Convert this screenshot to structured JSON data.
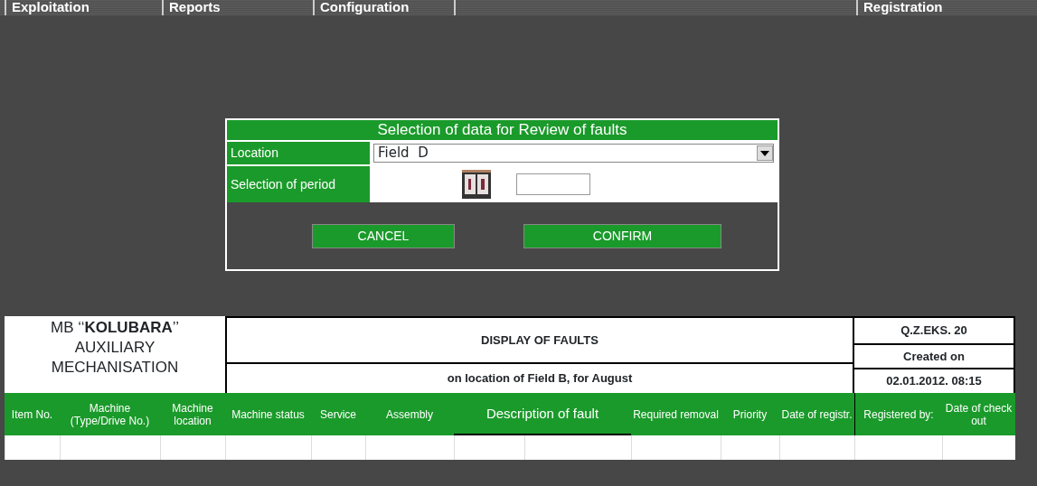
{
  "menu": {
    "left": [
      {
        "label": "Exploitation"
      },
      {
        "label": "Reports"
      },
      {
        "label": "Configuration"
      }
    ],
    "right": [
      {
        "label": "Registration"
      }
    ]
  },
  "dialog": {
    "title": "Selection of data for Review of faults",
    "location": {
      "label": "Location",
      "value": "Field  D"
    },
    "period": {
      "label": "Selection of period"
    },
    "buttons": [
      {
        "label": "CANCEL"
      },
      {
        "label": "CONFIRM"
      }
    ]
  },
  "report": {
    "org": [
      "MB ‘‘**KOLUBARA**’’",
      "AUXILIARY",
      "MECHANISATION"
    ],
    "title": "DISPLAY OF FAULTS",
    "subtitle": "on location of Field B, for August",
    "code": "Q.Z.EKS. 20",
    "created_label": "Created on",
    "created_on": "02.01.2012. 08:15"
  },
  "table": {
    "columns": [
      {
        "label": "Item No."
      },
      {
        "label": "Machine (Type/Drive No.)"
      },
      {
        "label": "Machine location"
      },
      {
        "label": "Machine status"
      },
      {
        "label": "Service"
      },
      {
        "label": "Assembly"
      },
      {
        "label": "Description of fault",
        "kind": "wide"
      },
      {
        "label": "Required removal"
      },
      {
        "label": "Priority"
      },
      {
        "label": "Date of registr."
      },
      {
        "label": "Registered by:"
      },
      {
        "label": "Date of check out"
      }
    ]
  }
}
